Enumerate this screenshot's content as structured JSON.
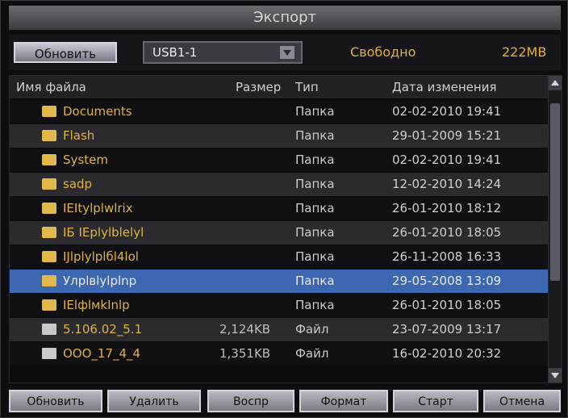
{
  "window": {
    "title": "Экспорт"
  },
  "toolbar": {
    "refresh_label": "Обновить",
    "device_selected": "USB1-1",
    "free_label": "Свободно",
    "free_value": "222MB"
  },
  "table": {
    "headers": {
      "name": "Имя файла",
      "size": "Размер",
      "type": "Тип",
      "date": "Дата изменения"
    },
    "rows": [
      {
        "icon": "folder-icon",
        "name": "Documents",
        "size": "",
        "type": "Папка",
        "date": "02-02-2010 19:41"
      },
      {
        "icon": "folder-icon",
        "name": "Flash",
        "size": "",
        "type": "Папка",
        "date": "29-01-2009 15:21"
      },
      {
        "icon": "folder-icon",
        "name": "System",
        "size": "",
        "type": "Папка",
        "date": "02-02-2010 19:41"
      },
      {
        "icon": "folder-icon",
        "name": "sadp",
        "size": "",
        "type": "Папка",
        "date": "12-02-2010 14:24"
      },
      {
        "icon": "folder-icon",
        "name": "IEItylplwlrix",
        "size": "",
        "type": "Папка",
        "date": "26-01-2010 18:12"
      },
      {
        "icon": "folder-icon",
        "name": "IБ IEplylblelyl",
        "size": "",
        "type": "Папка",
        "date": "26-01-2010 18:05"
      },
      {
        "icon": "folder-icon",
        "name": "IJlplylplбl4lol",
        "size": "",
        "type": "Папка",
        "date": "26-11-2008 16:33"
      },
      {
        "icon": "folder-icon",
        "name": "Улрlвlylplnp",
        "size": "",
        "type": "Папка",
        "date": "29-05-2008 13:09",
        "selected": true
      },
      {
        "icon": "folder-icon",
        "name": "IElфlмkInlp",
        "size": "",
        "type": "Папка",
        "date": "26-01-2010 18:05"
      },
      {
        "icon": "file-icon",
        "name": "5.106.02_5.1",
        "size": "2,124KB",
        "type": "Файл",
        "date": "23-07-2009 13:17"
      },
      {
        "icon": "file-icon",
        "name": "ООО_17_4_4",
        "size": "1,351KB",
        "type": "Файл",
        "date": "16-02-2010 20:32"
      }
    ]
  },
  "footer": {
    "buttons": [
      "Обновить",
      "Удалить",
      "Воспр",
      "Формат",
      "Старт",
      "Отмена"
    ]
  },
  "colors": {
    "accent_text": "#e0b43a",
    "selection": "#3c67b1"
  }
}
